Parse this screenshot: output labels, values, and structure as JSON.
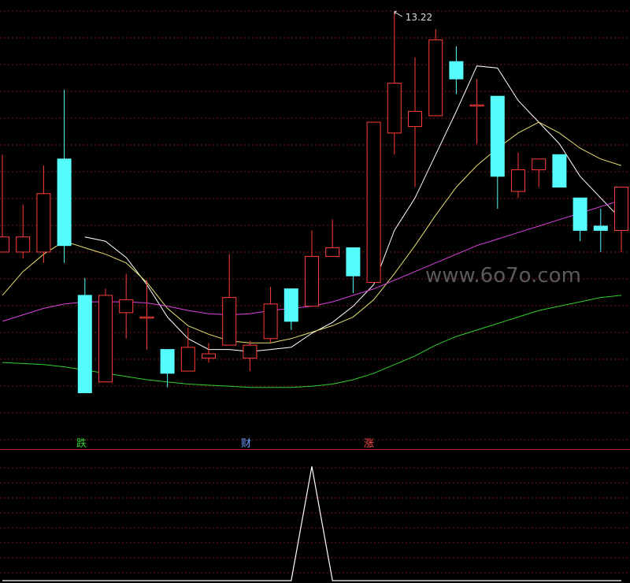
{
  "watermark": "www.6o7o.com",
  "colors": {
    "background": "#000000",
    "up": "#ff3c3c",
    "down": "#54fcfc",
    "grid": "#7a1a1a",
    "separator": "#b0242c",
    "ma_white": "#ffffff",
    "ma_yellow": "#e8e070",
    "ma_magenta": "#e040e0",
    "ma_green": "#30d030",
    "indicator": "#ffffff",
    "watermark": "#5a5a5a"
  },
  "labels": [
    {
      "text": "跌",
      "color": "#30d030"
    },
    {
      "text": "财",
      "color": "#6aa0ff"
    },
    {
      "text": "涨",
      "color": "#ff4848"
    }
  ],
  "chart_data": [
    {
      "type": "candlestick",
      "ylim": [
        9.5,
        13.3
      ],
      "high_label": "13.22",
      "candles": [
        {
          "o": 11.0,
          "c": 11.14,
          "h": 11.9,
          "l": 11.0
        },
        {
          "o": 11.0,
          "c": 11.14,
          "h": 11.44,
          "l": 10.94
        },
        {
          "o": 11.0,
          "c": 11.54,
          "h": 11.8,
          "l": 10.9
        },
        {
          "o": 11.86,
          "c": 11.06,
          "h": 12.5,
          "l": 10.9
        },
        {
          "o": 10.6,
          "c": 9.7,
          "h": 10.76,
          "l": 9.7
        },
        {
          "o": 9.8,
          "c": 10.6,
          "h": 10.66,
          "l": 9.8
        },
        {
          "o": 10.44,
          "c": 10.56,
          "h": 10.8,
          "l": 10.2
        },
        {
          "o": 10.4,
          "c": 10.4,
          "h": 10.74,
          "l": 10.1
        },
        {
          "o": 10.1,
          "c": 9.88,
          "h": 10.1,
          "l": 9.75
        },
        {
          "o": 9.9,
          "c": 10.12,
          "h": 10.3,
          "l": 9.9
        },
        {
          "o": 10.02,
          "c": 10.06,
          "h": 10.16,
          "l": 9.98
        },
        {
          "o": 10.14,
          "c": 10.58,
          "h": 10.98,
          "l": 10.14
        },
        {
          "o": 10.02,
          "c": 10.14,
          "h": 10.18,
          "l": 9.9
        },
        {
          "o": 10.2,
          "c": 10.52,
          "h": 10.68,
          "l": 10.16
        },
        {
          "o": 10.66,
          "c": 10.36,
          "h": 10.66,
          "l": 10.28
        },
        {
          "o": 10.5,
          "c": 10.96,
          "h": 11.2,
          "l": 10.5
        },
        {
          "o": 10.96,
          "c": 11.04,
          "h": 11.3,
          "l": 10.96
        },
        {
          "o": 11.04,
          "c": 10.78,
          "h": 11.04,
          "l": 10.62
        },
        {
          "o": 10.72,
          "c": 12.2,
          "h": 12.2,
          "l": 10.72
        },
        {
          "o": 12.1,
          "c": 12.56,
          "h": 13.22,
          "l": 11.9
        },
        {
          "o": 12.16,
          "c": 12.3,
          "h": 12.8,
          "l": 11.6
        },
        {
          "o": 12.26,
          "c": 12.96,
          "h": 13.06,
          "l": 12.26
        },
        {
          "o": 12.76,
          "c": 12.6,
          "h": 12.9,
          "l": 12.46
        },
        {
          "o": 12.36,
          "c": 12.36,
          "h": 12.6,
          "l": 12.0
        },
        {
          "o": 12.44,
          "c": 11.7,
          "h": 12.44,
          "l": 11.4
        },
        {
          "o": 11.56,
          "c": 11.76,
          "h": 11.92,
          "l": 11.5
        },
        {
          "o": 11.76,
          "c": 11.86,
          "h": 11.86,
          "l": 11.6
        },
        {
          "o": 11.9,
          "c": 11.6,
          "h": 11.9,
          "l": 11.6
        },
        {
          "o": 11.5,
          "c": 11.2,
          "h": 11.5,
          "l": 11.1
        },
        {
          "o": 11.24,
          "c": 11.2,
          "h": 11.4,
          "l": 11.0
        },
        {
          "o": 11.2,
          "c": 11.6,
          "h": 11.6,
          "l": 11.0
        }
      ],
      "ma": [
        {
          "color": "#ffffff",
          "values": [
            null,
            null,
            null,
            null,
            11.14,
            11.1,
            10.95,
            10.7,
            10.4,
            10.2,
            10.1,
            10.1,
            10.08,
            10.1,
            10.12,
            10.25,
            10.35,
            10.5,
            10.7,
            11.2,
            11.5,
            11.9,
            12.3,
            12.72,
            12.7,
            12.4,
            12.2,
            12.0,
            11.7,
            11.5,
            11.3
          ]
        },
        {
          "color": "#e8e070",
          "values": [
            10.6,
            10.82,
            10.98,
            11.1,
            11.04,
            10.98,
            10.9,
            10.72,
            10.48,
            10.32,
            10.24,
            10.18,
            10.16,
            10.16,
            10.2,
            10.26,
            10.32,
            10.4,
            10.56,
            10.8,
            11.06,
            11.34,
            11.6,
            11.8,
            11.96,
            12.1,
            12.2,
            12.1,
            11.96,
            11.86,
            11.8
          ]
        },
        {
          "color": "#e040e0",
          "values": [
            10.36,
            10.42,
            10.48,
            10.52,
            10.54,
            10.54,
            10.54,
            10.53,
            10.5,
            10.46,
            10.43,
            10.42,
            10.43,
            10.46,
            10.48,
            10.5,
            10.54,
            10.6,
            10.66,
            10.74,
            10.82,
            10.9,
            10.98,
            11.06,
            11.12,
            11.18,
            11.24,
            11.3,
            11.36,
            11.42,
            11.48
          ]
        },
        {
          "color": "#30d030",
          "values": [
            9.98,
            9.97,
            9.96,
            9.94,
            9.91,
            9.88,
            9.85,
            9.82,
            9.8,
            9.78,
            9.77,
            9.76,
            9.75,
            9.75,
            9.75,
            9.76,
            9.78,
            9.82,
            9.88,
            9.96,
            10.04,
            10.14,
            10.22,
            10.28,
            10.34,
            10.4,
            10.46,
            10.5,
            10.54,
            10.58,
            10.6
          ]
        }
      ]
    },
    {
      "type": "line",
      "name": "",
      "ylim": [
        0,
        1
      ],
      "spike_index": 15,
      "values": [
        0,
        0,
        0,
        0,
        0,
        0,
        0,
        0,
        0,
        0,
        0,
        0,
        0,
        0,
        0,
        1,
        0,
        0,
        0,
        0,
        0,
        0,
        0,
        0,
        0,
        0,
        0,
        0,
        0,
        0,
        0
      ]
    }
  ]
}
